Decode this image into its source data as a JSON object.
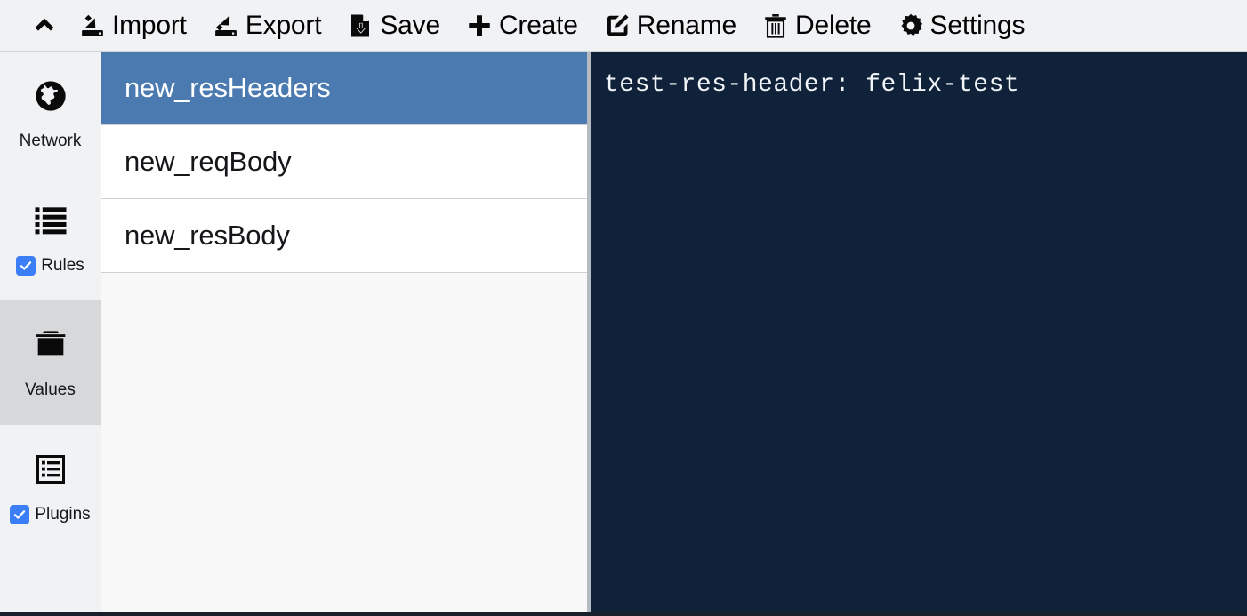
{
  "toolbar": {
    "collapse_icon": "chevron-up-icon",
    "buttons": [
      {
        "label": "Import",
        "icon": "import-icon"
      },
      {
        "label": "Export",
        "icon": "export-icon"
      },
      {
        "label": "Save",
        "icon": "save-icon"
      },
      {
        "label": "Create",
        "icon": "plus-icon"
      },
      {
        "label": "Rename",
        "icon": "edit-pencil-icon"
      },
      {
        "label": "Delete",
        "icon": "trash-icon"
      },
      {
        "label": "Settings",
        "icon": "gear-icon"
      }
    ]
  },
  "sidebar": {
    "items": [
      {
        "label": "Network",
        "icon": "globe-icon",
        "checkbox": false,
        "checked": false,
        "active": false
      },
      {
        "label": "Rules",
        "icon": "list-icon",
        "checkbox": true,
        "checked": true,
        "active": false
      },
      {
        "label": "Values",
        "icon": "folder-icon",
        "checkbox": false,
        "checked": false,
        "active": true
      },
      {
        "label": "Plugins",
        "icon": "plugins-icon",
        "checkbox": true,
        "checked": true,
        "active": false
      }
    ]
  },
  "list": {
    "items": [
      {
        "name": "new_resHeaders",
        "selected": true
      },
      {
        "name": "new_reqBody",
        "selected": false
      },
      {
        "name": "new_resBody",
        "selected": false
      }
    ]
  },
  "editor": {
    "lines": [
      "test-res-header: felix-test"
    ]
  },
  "colors": {
    "toolbar_bg": "#f1f2f4",
    "sidebar_bg": "#f1f2f4",
    "sidebar_active_bg": "#d7d8da",
    "list_bg": "#ffffff",
    "list_empty_bg": "#f8f8f8",
    "selection_blue": "#4a7ab0",
    "checkbox_blue": "#3b7ef6",
    "editor_bg": "#0f2239",
    "editor_fg": "#f2f5f8",
    "window_bottom": "#18202c"
  }
}
